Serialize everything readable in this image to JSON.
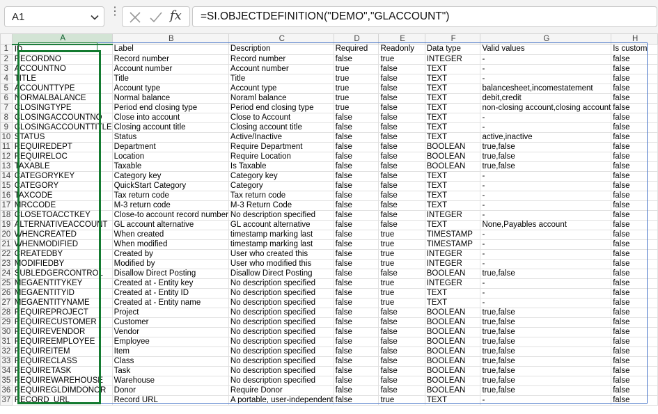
{
  "formula_bar": {
    "name_box": "A1",
    "fx_label": "fx",
    "formula": "=SI.OBJECTDEFINITION(\"DEMO\",\"GLACCOUNT\")"
  },
  "columns": [
    "A",
    "B",
    "C",
    "D",
    "E",
    "F",
    "G",
    "H"
  ],
  "rows": [
    [
      "ID",
      "Label",
      "Description",
      "Required",
      "Readonly",
      "Data type",
      "Valid values",
      "Is custom"
    ],
    [
      "RECORDNO",
      "Record number",
      "Record number",
      "false",
      "true",
      "INTEGER",
      "-",
      "false"
    ],
    [
      "ACCOUNTNO",
      "Account number",
      "Account number",
      "true",
      "false",
      "TEXT",
      "-",
      "false"
    ],
    [
      "TITLE",
      "Title",
      "Title",
      "true",
      "false",
      "TEXT",
      "-",
      "false"
    ],
    [
      "ACCOUNTTYPE",
      "Account type",
      "Account type",
      "true",
      "false",
      "TEXT",
      "balancesheet,incomestatement",
      "false"
    ],
    [
      "NORMALBALANCE",
      "Normal balance",
      "Noraml balance",
      "true",
      "false",
      "TEXT",
      "debit,credit",
      "false"
    ],
    [
      "CLOSINGTYPE",
      "Period end closing type",
      "Period end closing type",
      "true",
      "false",
      "TEXT",
      "non-closing account,closing account",
      "false"
    ],
    [
      "CLOSINGACCOUNTNO",
      "Close into account",
      "Close to Account",
      "false",
      "false",
      "TEXT",
      "-",
      "false"
    ],
    [
      "CLOSINGACCOUNTTITLE",
      "Closing account title",
      "Closing account title",
      "false",
      "false",
      "TEXT",
      "-",
      "false"
    ],
    [
      "STATUS",
      "Status",
      "Active/Inactive",
      "false",
      "false",
      "TEXT",
      "active,inactive",
      "false"
    ],
    [
      "REQUIREDEPT",
      "Department",
      "Require Department",
      "false",
      "false",
      "BOOLEAN",
      "true,false",
      "false"
    ],
    [
      "REQUIRELOC",
      "Location",
      "Require Location",
      "false",
      "false",
      "BOOLEAN",
      "true,false",
      "false"
    ],
    [
      "TAXABLE",
      "Taxable",
      "Is Taxable",
      "false",
      "false",
      "BOOLEAN",
      "true,false",
      "false"
    ],
    [
      "CATEGORYKEY",
      "Category key",
      "Category key",
      "false",
      "false",
      "TEXT",
      "-",
      "false"
    ],
    [
      "CATEGORY",
      "QuickStart Category",
      "Category",
      "false",
      "false",
      "TEXT",
      "-",
      "false"
    ],
    [
      "TAXCODE",
      "Tax return code",
      "Tax return code",
      "false",
      "false",
      "TEXT",
      "-",
      "false"
    ],
    [
      "MRCCODE",
      "M-3 return code",
      "M-3 Return Code",
      "false",
      "false",
      "TEXT",
      "-",
      "false"
    ],
    [
      "CLOSETOACCTKEY",
      "Close-to account record number",
      "No description specified",
      "false",
      "false",
      "INTEGER",
      "-",
      "false"
    ],
    [
      "ALTERNATIVEACCOUNT",
      "GL account alternative",
      "GL account alternative",
      "false",
      "false",
      "TEXT",
      "None,Payables account",
      "false"
    ],
    [
      "WHENCREATED",
      "When created",
      "timestamp marking last",
      "false",
      "true",
      "TIMESTAMP",
      "-",
      "false"
    ],
    [
      "WHENMODIFIED",
      "When modified",
      "timestamp marking last",
      "false",
      "true",
      "TIMESTAMP",
      "-",
      "false"
    ],
    [
      "CREATEDBY",
      "Created by",
      "User who created this",
      "false",
      "true",
      "INTEGER",
      "-",
      "false"
    ],
    [
      "MODIFIEDBY",
      "Modified by",
      "User who modified this",
      "false",
      "true",
      "INTEGER",
      "-",
      "false"
    ],
    [
      "SUBLEDGERCONTROL",
      "Disallow Direct Posting",
      "Disallow Direct Posting",
      "false",
      "false",
      "BOOLEAN",
      "true,false",
      "false"
    ],
    [
      "MEGAENTITYKEY",
      "Created at - Entity key",
      "No description specified",
      "false",
      "true",
      "INTEGER",
      "-",
      "false"
    ],
    [
      "MEGAENTITYID",
      "Created at - Entity ID",
      "No description specified",
      "false",
      "true",
      "TEXT",
      "-",
      "false"
    ],
    [
      "MEGAENTITYNAME",
      "Created at - Entity name",
      "No description specified",
      "false",
      "true",
      "TEXT",
      "-",
      "false"
    ],
    [
      "REQUIREPROJECT",
      "Project",
      "No description specified",
      "false",
      "false",
      "BOOLEAN",
      "true,false",
      "false"
    ],
    [
      "REQUIRECUSTOMER",
      "Customer",
      "No description specified",
      "false",
      "false",
      "BOOLEAN",
      "true,false",
      "false"
    ],
    [
      "REQUIREVENDOR",
      "Vendor",
      "No description specified",
      "false",
      "false",
      "BOOLEAN",
      "true,false",
      "false"
    ],
    [
      "REQUIREEMPLOYEE",
      "Employee",
      "No description specified",
      "false",
      "false",
      "BOOLEAN",
      "true,false",
      "false"
    ],
    [
      "REQUIREITEM",
      "Item",
      "No description specified",
      "false",
      "false",
      "BOOLEAN",
      "true,false",
      "false"
    ],
    [
      "REQUIRECLASS",
      "Class",
      "No description specified",
      "false",
      "false",
      "BOOLEAN",
      "true,false",
      "false"
    ],
    [
      "REQUIRETASK",
      "Task",
      "No description specified",
      "false",
      "false",
      "BOOLEAN",
      "true,false",
      "false"
    ],
    [
      "REQUIREWAREHOUSE",
      "Warehouse",
      "No description specified",
      "false",
      "false",
      "BOOLEAN",
      "true,false",
      "false"
    ],
    [
      "REQUIREGLDIMDONOR",
      "Donor",
      "Require Donor",
      "false",
      "false",
      "BOOLEAN",
      "true,false",
      "false"
    ],
    [
      "RECORD_URL",
      "Record URL",
      " A portable, user-independent",
      "false",
      "true",
      "TEXT",
      "-",
      "false"
    ]
  ]
}
